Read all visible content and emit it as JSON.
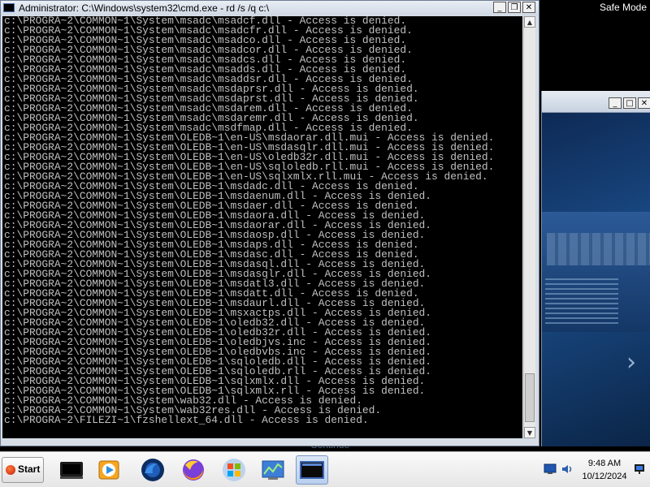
{
  "desktop": {
    "safe_mode_label": "Safe Mode"
  },
  "background_window": {
    "continue_label": "Continue"
  },
  "cmd": {
    "title": "Administrator: C:\\Windows\\system32\\cmd.exe - rd  /s /q c:\\",
    "lines": [
      "c:\\PROGRA~2\\COMMON~1\\System\\msadc\\msadcf.dll - Access is denied.",
      "c:\\PROGRA~2\\COMMON~1\\System\\msadc\\msadcfr.dll - Access is denied.",
      "c:\\PROGRA~2\\COMMON~1\\System\\msadc\\msadco.dll - Access is denied.",
      "c:\\PROGRA~2\\COMMON~1\\System\\msadc\\msadcor.dll - Access is denied.",
      "c:\\PROGRA~2\\COMMON~1\\System\\msadc\\msadcs.dll - Access is denied.",
      "c:\\PROGRA~2\\COMMON~1\\System\\msadc\\msadds.dll - Access is denied.",
      "c:\\PROGRA~2\\COMMON~1\\System\\msadc\\msaddsr.dll - Access is denied.",
      "c:\\PROGRA~2\\COMMON~1\\System\\msadc\\msdaprsr.dll - Access is denied.",
      "c:\\PROGRA~2\\COMMON~1\\System\\msadc\\msdaprst.dll - Access is denied.",
      "c:\\PROGRA~2\\COMMON~1\\System\\msadc\\msdarem.dll - Access is denied.",
      "c:\\PROGRA~2\\COMMON~1\\System\\msadc\\msdaremr.dll - Access is denied.",
      "c:\\PROGRA~2\\COMMON~1\\System\\msadc\\msdfmap.dll - Access is denied.",
      "c:\\PROGRA~2\\COMMON~1\\System\\OLEDB~1\\en-US\\msdaorar.dll.mui - Access is denied.",
      "c:\\PROGRA~2\\COMMON~1\\System\\OLEDB~1\\en-US\\msdasqlr.dll.mui - Access is denied.",
      "c:\\PROGRA~2\\COMMON~1\\System\\OLEDB~1\\en-US\\oledb32r.dll.mui - Access is denied.",
      "c:\\PROGRA~2\\COMMON~1\\System\\OLEDB~1\\en-US\\sqloledb.rll.mui - Access is denied.",
      "c:\\PROGRA~2\\COMMON~1\\System\\OLEDB~1\\en-US\\sqlxmlx.rll.mui - Access is denied.",
      "c:\\PROGRA~2\\COMMON~1\\System\\OLEDB~1\\msdadc.dll - Access is denied.",
      "c:\\PROGRA~2\\COMMON~1\\System\\OLEDB~1\\msdaenum.dll - Access is denied.",
      "c:\\PROGRA~2\\COMMON~1\\System\\OLEDB~1\\msdaer.dll - Access is denied.",
      "c:\\PROGRA~2\\COMMON~1\\System\\OLEDB~1\\msdaora.dll - Access is denied.",
      "c:\\PROGRA~2\\COMMON~1\\System\\OLEDB~1\\msdaorar.dll - Access is denied.",
      "c:\\PROGRA~2\\COMMON~1\\System\\OLEDB~1\\msdaosp.dll - Access is denied.",
      "c:\\PROGRA~2\\COMMON~1\\System\\OLEDB~1\\msdaps.dll - Access is denied.",
      "c:\\PROGRA~2\\COMMON~1\\System\\OLEDB~1\\msdasc.dll - Access is denied.",
      "c:\\PROGRA~2\\COMMON~1\\System\\OLEDB~1\\msdasql.dll - Access is denied.",
      "c:\\PROGRA~2\\COMMON~1\\System\\OLEDB~1\\msdasqlr.dll - Access is denied.",
      "c:\\PROGRA~2\\COMMON~1\\System\\OLEDB~1\\msdatl3.dll - Access is denied.",
      "c:\\PROGRA~2\\COMMON~1\\System\\OLEDB~1\\msdatt.dll - Access is denied.",
      "c:\\PROGRA~2\\COMMON~1\\System\\OLEDB~1\\msdaurl.dll - Access is denied.",
      "c:\\PROGRA~2\\COMMON~1\\System\\OLEDB~1\\msxactps.dll - Access is denied.",
      "c:\\PROGRA~2\\COMMON~1\\System\\OLEDB~1\\oledb32.dll - Access is denied.",
      "c:\\PROGRA~2\\COMMON~1\\System\\OLEDB~1\\oledb32r.dll - Access is denied.",
      "c:\\PROGRA~2\\COMMON~1\\System\\OLEDB~1\\oledbjvs.inc - Access is denied.",
      "c:\\PROGRA~2\\COMMON~1\\System\\OLEDB~1\\oledbvbs.inc - Access is denied.",
      "c:\\PROGRA~2\\COMMON~1\\System\\OLEDB~1\\sqloledb.dll - Access is denied.",
      "c:\\PROGRA~2\\COMMON~1\\System\\OLEDB~1\\sqloledb.rll - Access is denied.",
      "c:\\PROGRA~2\\COMMON~1\\System\\OLEDB~1\\sqlxmlx.dll - Access is denied.",
      "c:\\PROGRA~2\\COMMON~1\\System\\OLEDB~1\\sqlxmlx.rll - Access is denied.",
      "c:\\PROGRA~2\\COMMON~1\\System\\wab32.dll - Access is denied.",
      "c:\\PROGRA~2\\COMMON~1\\System\\wab32res.dll - Access is denied.",
      "c:\\PROGRA~2\\FILEZI~1\\fzshellext_64.dll - Access is denied."
    ]
  },
  "taskbar": {
    "start_label": "Start",
    "clock_time": "9:48 AM",
    "clock_date": "10/12/2024"
  },
  "icons": {
    "start": "windows-orb-icon",
    "items": [
      "console-icon",
      "media-player-icon",
      "firefox-dark-icon",
      "firefox-icon",
      "windows-logo-icon",
      "task-manager-icon",
      "cmd-icon"
    ],
    "tray": [
      "network-icon",
      "volume-icon",
      "flag-icon"
    ]
  }
}
